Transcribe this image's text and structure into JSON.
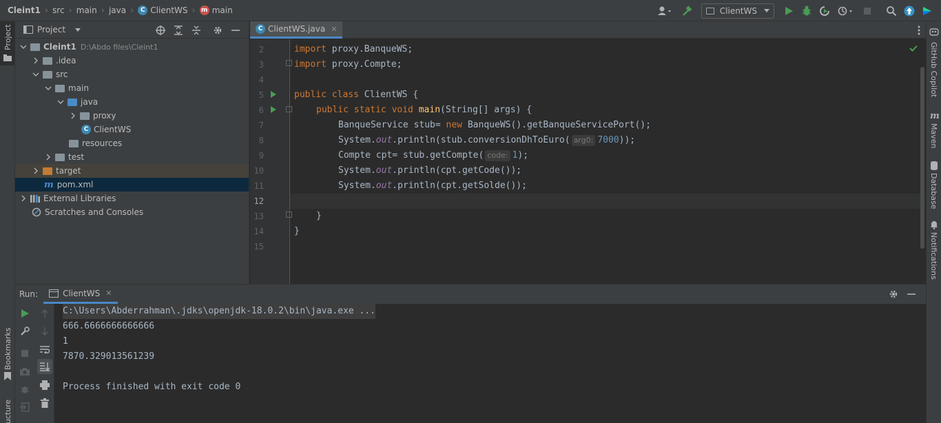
{
  "breadcrumbs": [
    "Cleint1",
    "src",
    "main",
    "java",
    "ClientWS",
    "main"
  ],
  "run_config": "ClientWS",
  "left_strip": {
    "project_label": "Project",
    "bookmarks_label": "Bookmarks",
    "structure_label": "Structure"
  },
  "right_strip": {
    "copilot": "GitHub Copilot",
    "maven": "Maven",
    "database": "Database",
    "notifications": "Notifications"
  },
  "project_panel": {
    "title": "Project",
    "tree": [
      {
        "label": "Cleint1",
        "hint": "D:\\Abdo files\\Cleint1"
      },
      {
        "label": ".idea"
      },
      {
        "label": "src"
      },
      {
        "label": "main"
      },
      {
        "label": "java"
      },
      {
        "label": "proxy"
      },
      {
        "label": "ClientWS"
      },
      {
        "label": "resources"
      },
      {
        "label": "test"
      },
      {
        "label": "target"
      },
      {
        "label": "pom.xml"
      },
      {
        "label": "External Libraries"
      },
      {
        "label": "Scratches and Consoles"
      }
    ]
  },
  "editor": {
    "tab_label": "ClientWS.java",
    "lines": [
      {
        "num": "2"
      },
      {
        "num": "3"
      },
      {
        "num": "4"
      },
      {
        "num": "5"
      },
      {
        "num": "6"
      },
      {
        "num": "7"
      },
      {
        "num": "8"
      },
      {
        "num": "9"
      },
      {
        "num": "10"
      },
      {
        "num": "11"
      },
      {
        "num": "12"
      },
      {
        "num": "13"
      },
      {
        "num": "14"
      },
      {
        "num": "15"
      }
    ],
    "code": {
      "l2_kw": "import",
      "l2_rest": " proxy.BanqueWS;",
      "l3_kw": "import",
      "l3_rest": " proxy.Compte;",
      "l5_kw": "public class",
      "l5_rest": " ClientWS {",
      "l6_kw": "public static void",
      "l6_fn": "main",
      "l6_rest": "(String[] args) {",
      "l7_a": "BanqueService stub= ",
      "l7_kw": "new",
      "l7_b": " BanqueWS().getBanqueServicePort();",
      "l8_a": "System.",
      "l8_out": "out",
      "l8_b": ".println(stub.conversionDhToEuro(",
      "l8_hint": "arg0:",
      "l8_num": "7000",
      "l8_c": "));",
      "l9_a": "Compte cpt= stub.getCompte(",
      "l9_hint": "code:",
      "l9_num": "1",
      "l9_c": ");",
      "l10_a": "System.",
      "l10_out": "out",
      "l10_b": ".println(cpt.getCode());",
      "l11_a": "System.",
      "l11_out": "out",
      "l11_b": ".println(cpt.getSolde());",
      "l13": "}",
      "l14": "}"
    }
  },
  "run_panel": {
    "label": "Run:",
    "tab_label": "ClientWS",
    "output": [
      "C:\\Users\\Abderrahman\\.jdks\\openjdk-18.0.2\\bin\\java.exe ...",
      "666.6666666666666",
      "1",
      "7870.329013561239",
      "",
      "Process finished with exit code 0"
    ]
  },
  "colors": {
    "accent": "#4a88c7",
    "run_green": "#499c54",
    "bg_editor": "#2b2b2b",
    "bg_panel": "#3c3f41"
  }
}
